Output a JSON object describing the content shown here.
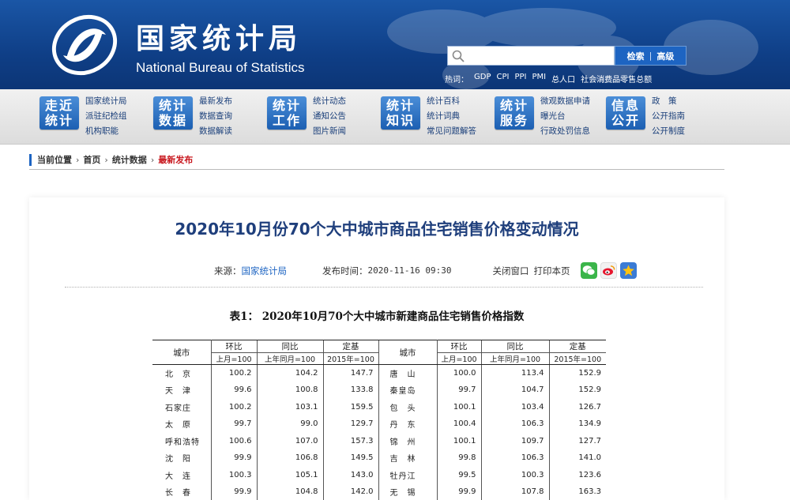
{
  "header": {
    "site_name_cn": "国家统计局",
    "site_name_en": "National Bureau of Statistics",
    "search": {
      "placeholder": "",
      "button_search": "检索",
      "button_advanced": "高级"
    },
    "hot_label": "热词：",
    "hot_words": [
      "GDP",
      "CPI",
      "PPI",
      "PMI",
      "总人口",
      "社会消费品零售总额"
    ]
  },
  "nav": [
    {
      "badge": [
        "走近",
        "统计"
      ],
      "links": [
        "国家统计局",
        "派驻纪检组",
        "机构职能"
      ]
    },
    {
      "badge": [
        "统计",
        "数据"
      ],
      "links": [
        "最新发布",
        "数据查询",
        "数据解读"
      ]
    },
    {
      "badge": [
        "统计",
        "工作"
      ],
      "links": [
        "统计动态",
        "通知公告",
        "图片新闻"
      ]
    },
    {
      "badge": [
        "统计",
        "知识"
      ],
      "links": [
        "统计百科",
        "统计词典",
        "常见问题解答"
      ]
    },
    {
      "badge": [
        "统计",
        "服务"
      ],
      "links": [
        "微观数据申请",
        "曝光台",
        "行政处罚信息"
      ]
    },
    {
      "badge": [
        "信息",
        "公开"
      ],
      "links": [
        "政　策",
        "公开指南",
        "公开制度"
      ]
    }
  ],
  "breadcrumb": {
    "label": "当前位置",
    "items": [
      "首页",
      "统计数据"
    ],
    "current": "最新发布",
    "separator": "›"
  },
  "article": {
    "title": "2020年10月份70个大中城市商品住宅销售价格变动情况",
    "source_label": "来源：",
    "source": "国家统计局",
    "time_label": "发布时间：",
    "time": "2020-11-16 09:30",
    "close_label": "关闭窗口",
    "print_label": "打印本页",
    "share_icons": [
      "wechat-icon",
      "weibo-icon",
      "qzone-star-icon"
    ]
  },
  "table": {
    "caption": "表1：  2020年10月70个大中城市新建商品住宅销售价格指数",
    "header": {
      "city": "城市",
      "mom": "环比",
      "yoy": "同比",
      "base": "定基",
      "mom_base": "上月=100",
      "yoy_base": "上年同月=100",
      "base_base": "2015年=100"
    },
    "rows": [
      {
        "left": [
          "北　京",
          "100.2",
          "104.2",
          "147.7"
        ],
        "right": [
          "唐　山",
          "100.0",
          "113.4",
          "152.9"
        ]
      },
      {
        "left": [
          "天　津",
          "99.6",
          "100.8",
          "133.8"
        ],
        "right": [
          "秦皇岛",
          "99.7",
          "104.7",
          "152.9"
        ]
      },
      {
        "left": [
          "石家庄",
          "100.2",
          "103.1",
          "159.5"
        ],
        "right": [
          "包　头",
          "100.1",
          "103.4",
          "126.7"
        ]
      },
      {
        "left": [
          "太　原",
          "99.7",
          "99.0",
          "129.7"
        ],
        "right": [
          "丹　东",
          "100.4",
          "106.3",
          "134.9"
        ]
      },
      {
        "left": [
          "呼和浩特",
          "100.6",
          "107.0",
          "157.3"
        ],
        "right": [
          "锦　州",
          "100.1",
          "109.7",
          "127.7"
        ]
      },
      {
        "left": [
          "沈　阳",
          "99.9",
          "106.8",
          "149.5"
        ],
        "right": [
          "吉　林",
          "99.8",
          "106.3",
          "141.0"
        ]
      },
      {
        "left": [
          "大　连",
          "100.3",
          "105.1",
          "143.0"
        ],
        "right": [
          "牡丹江",
          "99.5",
          "100.3",
          "123.6"
        ]
      },
      {
        "left": [
          "长　春",
          "99.9",
          "104.8",
          "142.0"
        ],
        "right": [
          "无　锡",
          "99.9",
          "107.8",
          "163.3"
        ]
      }
    ]
  },
  "colors": {
    "brand_blue": "#1d64c2",
    "title_blue": "#1f3f7c",
    "current_red": "#c8161d"
  }
}
